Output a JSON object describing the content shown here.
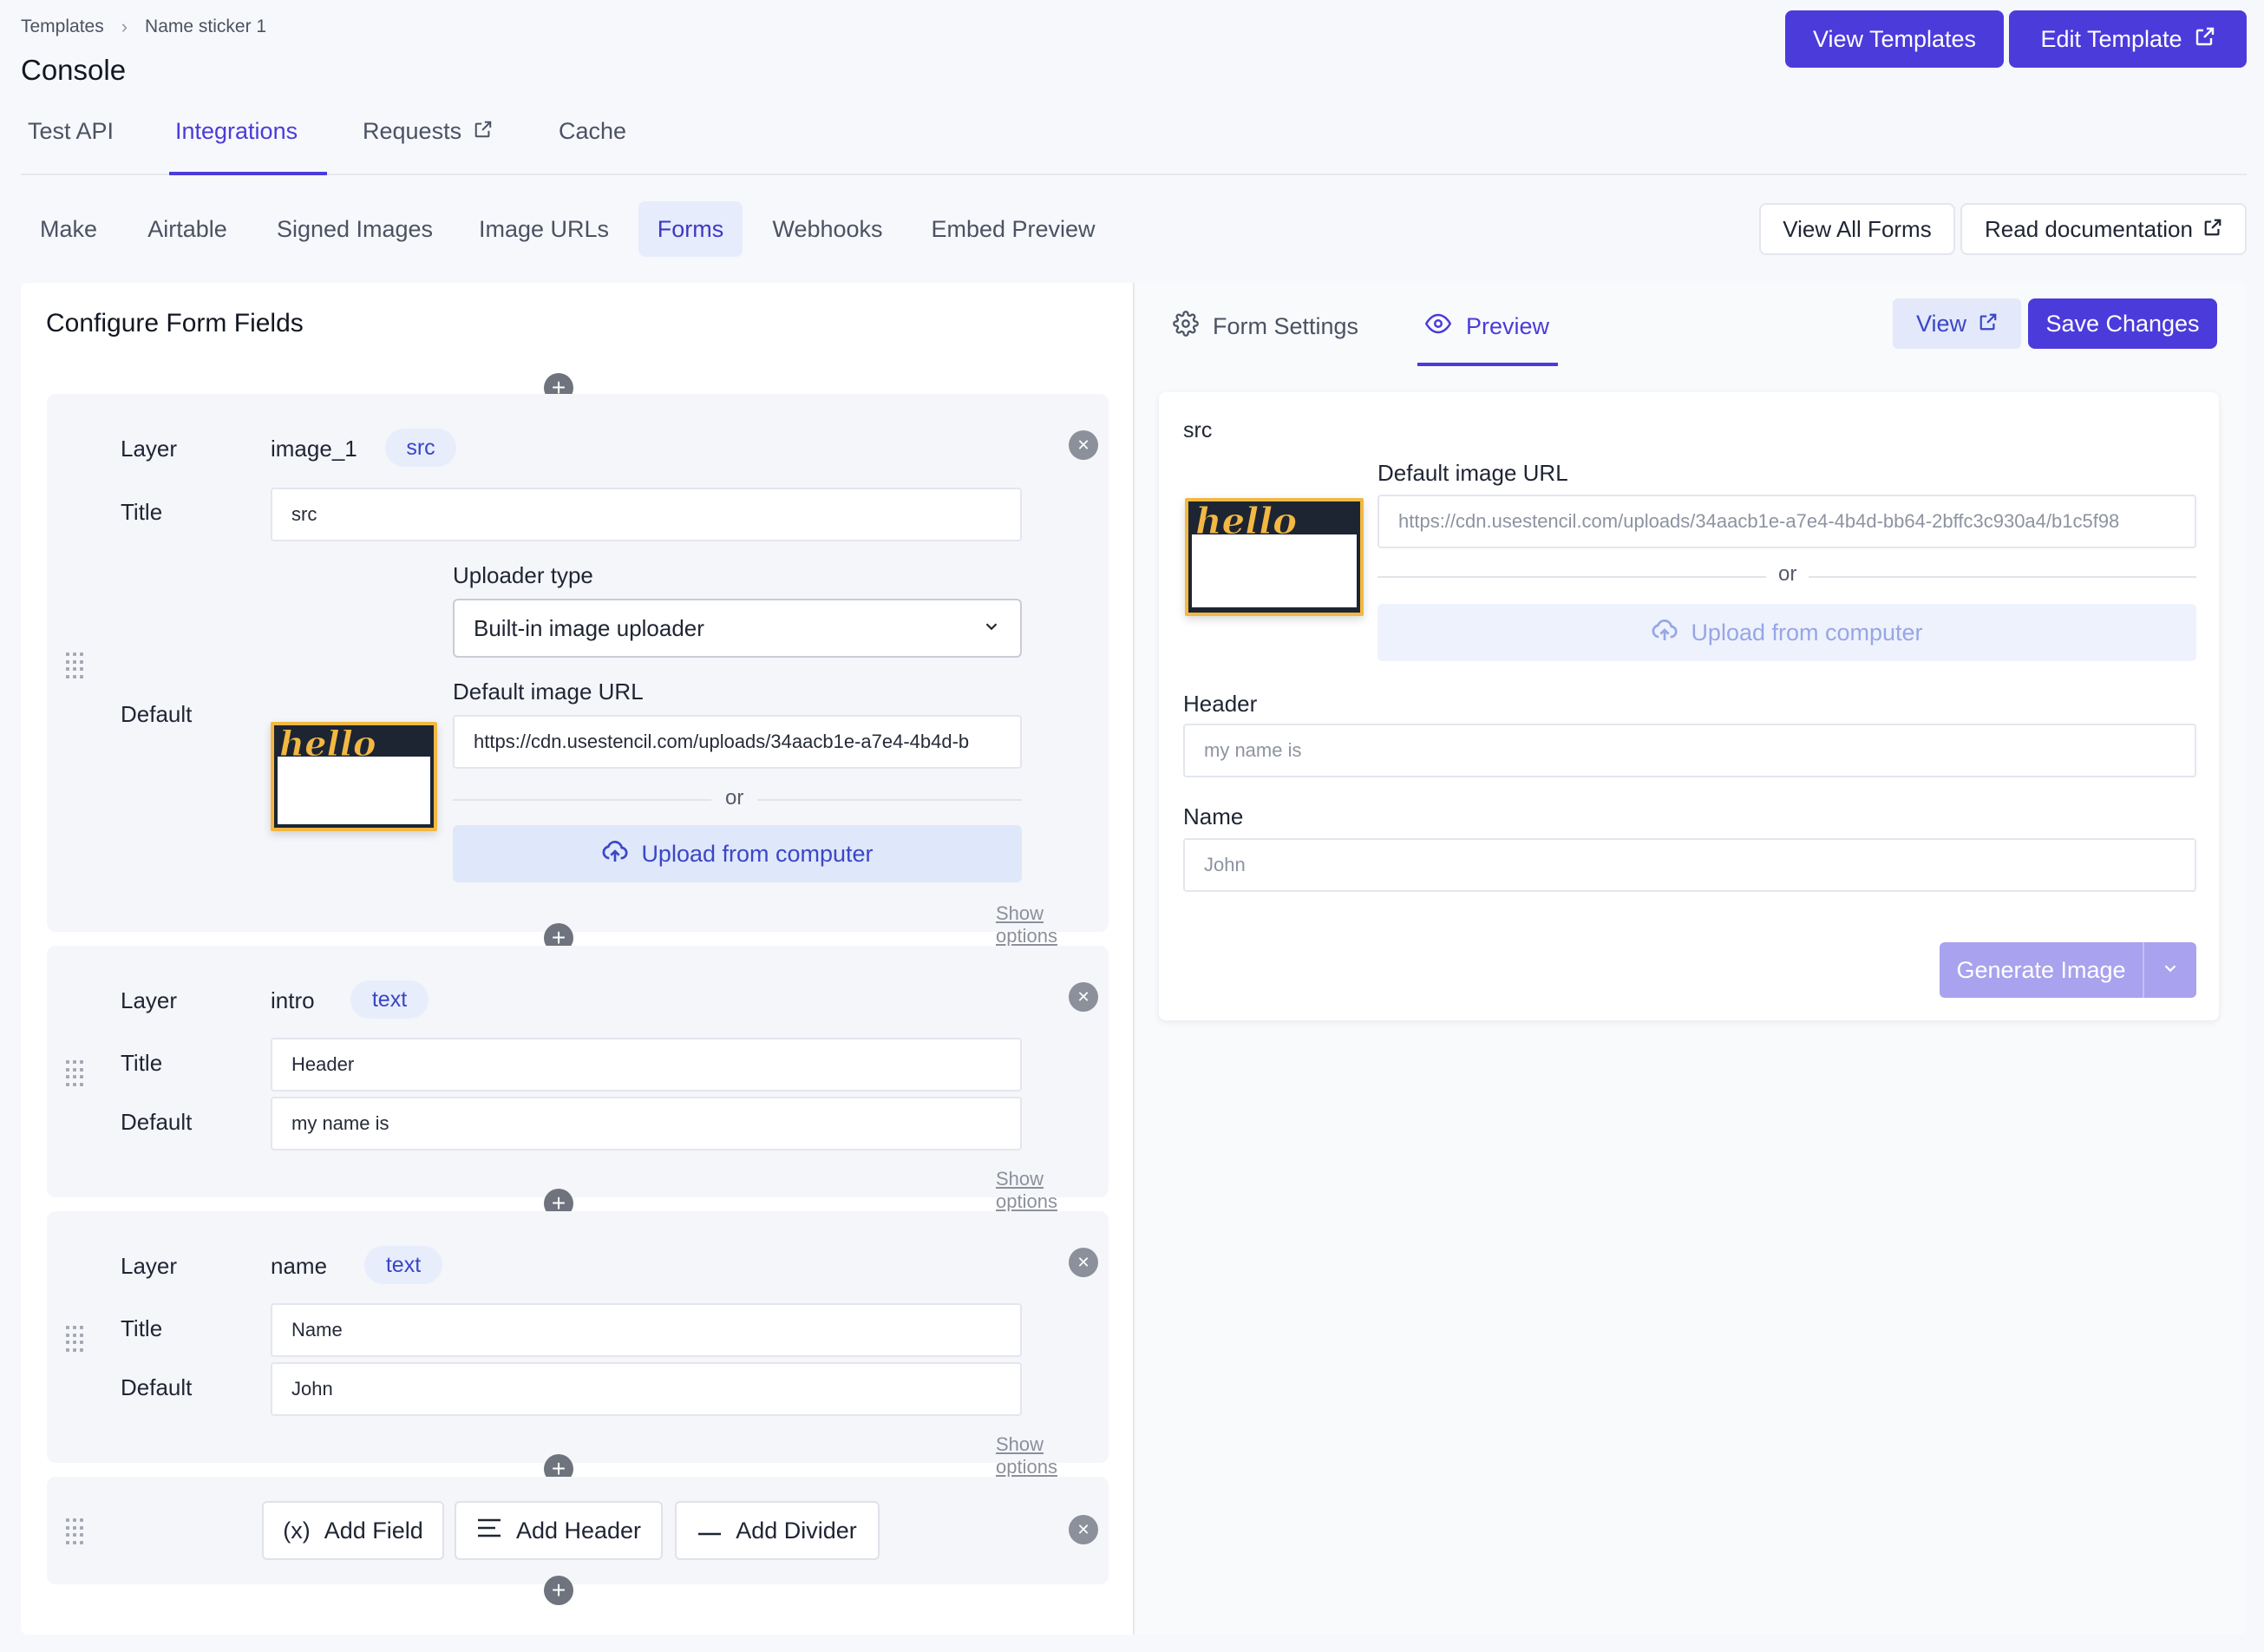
{
  "breadcrumb": {
    "root": "Templates",
    "current": "Name sticker 1"
  },
  "page_title": "Console",
  "header_buttons": {
    "view_templates": "View Templates",
    "edit_template": "Edit Template"
  },
  "top_tabs": [
    {
      "label": "Test API",
      "active": false
    },
    {
      "label": "Integrations",
      "active": true
    },
    {
      "label": "Requests",
      "active": false,
      "external": true
    },
    {
      "label": "Cache",
      "active": false
    }
  ],
  "sub_tabs": [
    {
      "label": "Make"
    },
    {
      "label": "Airtable"
    },
    {
      "label": "Signed Images"
    },
    {
      "label": "Image URLs"
    },
    {
      "label": "Forms",
      "active": true
    },
    {
      "label": "Webhooks"
    },
    {
      "label": "Embed Preview"
    }
  ],
  "sub_actions": {
    "view_all_forms": "View All Forms",
    "read_docs": "Read documentation"
  },
  "left": {
    "heading": "Configure Form Fields",
    "labels": {
      "layer": "Layer",
      "title": "Title",
      "default": "Default"
    },
    "show_options": "Show options",
    "fields": [
      {
        "layer_name": "image_1",
        "layer_type": "src",
        "title": "src",
        "uploader_type_label": "Uploader type",
        "uploader_type_value": "Built-in image uploader",
        "default_url_label": "Default image URL",
        "default_url_value": "https://cdn.usestencil.com/uploads/34aacb1e-a7e4-4b4d-b",
        "or": "or",
        "upload_label": "Upload from computer"
      },
      {
        "layer_name": "intro",
        "layer_type": "text",
        "title": "Header",
        "default": "my name is"
      },
      {
        "layer_name": "name",
        "layer_type": "text",
        "title": "Name",
        "default": "John"
      }
    ],
    "add_buttons": {
      "field": "Add Field",
      "header": "Add Header",
      "divider": "Add Divider"
    },
    "field_icon": "(x)"
  },
  "right": {
    "tabs": {
      "settings": "Form Settings",
      "preview": "Preview"
    },
    "buttons": {
      "view": "View",
      "save": "Save Changes"
    },
    "preview": {
      "src_label": "src",
      "default_url_label": "Default image URL",
      "default_url_placeholder": "https://cdn.usestencil.com/uploads/34aacb1e-a7e4-4b4d-bb64-2bffc3c930a4/b1c5f98",
      "or": "or",
      "upload_label": "Upload from computer",
      "header_label": "Header",
      "header_placeholder": "my name is",
      "name_label": "Name",
      "name_placeholder": "John",
      "generate": "Generate Image"
    }
  },
  "thumbnail_text": "hello",
  "colors": {
    "accent": "#4b3bdb",
    "badge_bg": "#e7edfb",
    "thumb_border": "#f2b843",
    "thumb_dark": "#1d2533"
  }
}
